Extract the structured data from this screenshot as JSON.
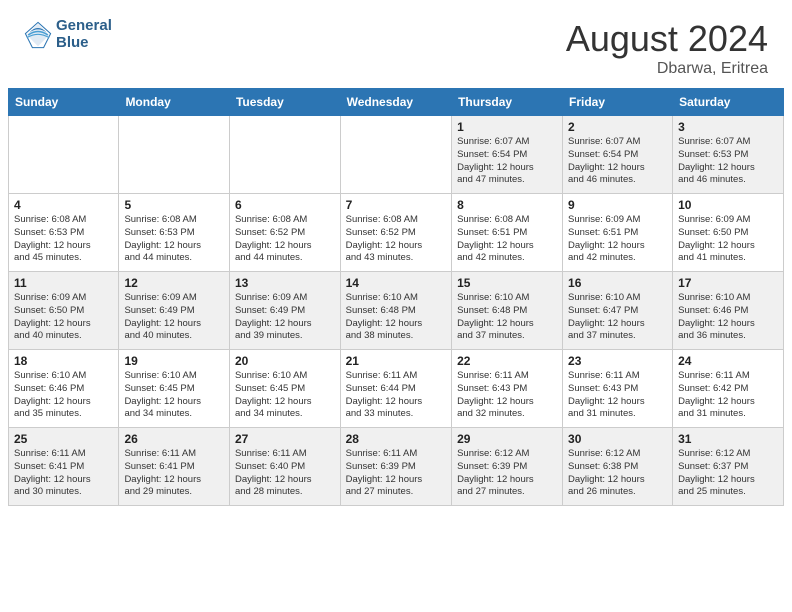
{
  "header": {
    "logo": {
      "general": "General",
      "blue": "Blue"
    },
    "title": "August 2024",
    "location": "Dbarwa, Eritrea"
  },
  "weekdays": [
    "Sunday",
    "Monday",
    "Tuesday",
    "Wednesday",
    "Thursday",
    "Friday",
    "Saturday"
  ],
  "weeks": [
    [
      {
        "day": "",
        "info": ""
      },
      {
        "day": "",
        "info": ""
      },
      {
        "day": "",
        "info": ""
      },
      {
        "day": "",
        "info": ""
      },
      {
        "day": "1",
        "info": "Sunrise: 6:07 AM\nSunset: 6:54 PM\nDaylight: 12 hours\nand 47 minutes."
      },
      {
        "day": "2",
        "info": "Sunrise: 6:07 AM\nSunset: 6:54 PM\nDaylight: 12 hours\nand 46 minutes."
      },
      {
        "day": "3",
        "info": "Sunrise: 6:07 AM\nSunset: 6:53 PM\nDaylight: 12 hours\nand 46 minutes."
      }
    ],
    [
      {
        "day": "4",
        "info": "Sunrise: 6:08 AM\nSunset: 6:53 PM\nDaylight: 12 hours\nand 45 minutes."
      },
      {
        "day": "5",
        "info": "Sunrise: 6:08 AM\nSunset: 6:53 PM\nDaylight: 12 hours\nand 44 minutes."
      },
      {
        "day": "6",
        "info": "Sunrise: 6:08 AM\nSunset: 6:52 PM\nDaylight: 12 hours\nand 44 minutes."
      },
      {
        "day": "7",
        "info": "Sunrise: 6:08 AM\nSunset: 6:52 PM\nDaylight: 12 hours\nand 43 minutes."
      },
      {
        "day": "8",
        "info": "Sunrise: 6:08 AM\nSunset: 6:51 PM\nDaylight: 12 hours\nand 42 minutes."
      },
      {
        "day": "9",
        "info": "Sunrise: 6:09 AM\nSunset: 6:51 PM\nDaylight: 12 hours\nand 42 minutes."
      },
      {
        "day": "10",
        "info": "Sunrise: 6:09 AM\nSunset: 6:50 PM\nDaylight: 12 hours\nand 41 minutes."
      }
    ],
    [
      {
        "day": "11",
        "info": "Sunrise: 6:09 AM\nSunset: 6:50 PM\nDaylight: 12 hours\nand 40 minutes."
      },
      {
        "day": "12",
        "info": "Sunrise: 6:09 AM\nSunset: 6:49 PM\nDaylight: 12 hours\nand 40 minutes."
      },
      {
        "day": "13",
        "info": "Sunrise: 6:09 AM\nSunset: 6:49 PM\nDaylight: 12 hours\nand 39 minutes."
      },
      {
        "day": "14",
        "info": "Sunrise: 6:10 AM\nSunset: 6:48 PM\nDaylight: 12 hours\nand 38 minutes."
      },
      {
        "day": "15",
        "info": "Sunrise: 6:10 AM\nSunset: 6:48 PM\nDaylight: 12 hours\nand 37 minutes."
      },
      {
        "day": "16",
        "info": "Sunrise: 6:10 AM\nSunset: 6:47 PM\nDaylight: 12 hours\nand 37 minutes."
      },
      {
        "day": "17",
        "info": "Sunrise: 6:10 AM\nSunset: 6:46 PM\nDaylight: 12 hours\nand 36 minutes."
      }
    ],
    [
      {
        "day": "18",
        "info": "Sunrise: 6:10 AM\nSunset: 6:46 PM\nDaylight: 12 hours\nand 35 minutes."
      },
      {
        "day": "19",
        "info": "Sunrise: 6:10 AM\nSunset: 6:45 PM\nDaylight: 12 hours\nand 34 minutes."
      },
      {
        "day": "20",
        "info": "Sunrise: 6:10 AM\nSunset: 6:45 PM\nDaylight: 12 hours\nand 34 minutes."
      },
      {
        "day": "21",
        "info": "Sunrise: 6:11 AM\nSunset: 6:44 PM\nDaylight: 12 hours\nand 33 minutes."
      },
      {
        "day": "22",
        "info": "Sunrise: 6:11 AM\nSunset: 6:43 PM\nDaylight: 12 hours\nand 32 minutes."
      },
      {
        "day": "23",
        "info": "Sunrise: 6:11 AM\nSunset: 6:43 PM\nDaylight: 12 hours\nand 31 minutes."
      },
      {
        "day": "24",
        "info": "Sunrise: 6:11 AM\nSunset: 6:42 PM\nDaylight: 12 hours\nand 31 minutes."
      }
    ],
    [
      {
        "day": "25",
        "info": "Sunrise: 6:11 AM\nSunset: 6:41 PM\nDaylight: 12 hours\nand 30 minutes."
      },
      {
        "day": "26",
        "info": "Sunrise: 6:11 AM\nSunset: 6:41 PM\nDaylight: 12 hours\nand 29 minutes."
      },
      {
        "day": "27",
        "info": "Sunrise: 6:11 AM\nSunset: 6:40 PM\nDaylight: 12 hours\nand 28 minutes."
      },
      {
        "day": "28",
        "info": "Sunrise: 6:11 AM\nSunset: 6:39 PM\nDaylight: 12 hours\nand 27 minutes."
      },
      {
        "day": "29",
        "info": "Sunrise: 6:12 AM\nSunset: 6:39 PM\nDaylight: 12 hours\nand 27 minutes."
      },
      {
        "day": "30",
        "info": "Sunrise: 6:12 AM\nSunset: 6:38 PM\nDaylight: 12 hours\nand 26 minutes."
      },
      {
        "day": "31",
        "info": "Sunrise: 6:12 AM\nSunset: 6:37 PM\nDaylight: 12 hours\nand 25 minutes."
      }
    ]
  ]
}
